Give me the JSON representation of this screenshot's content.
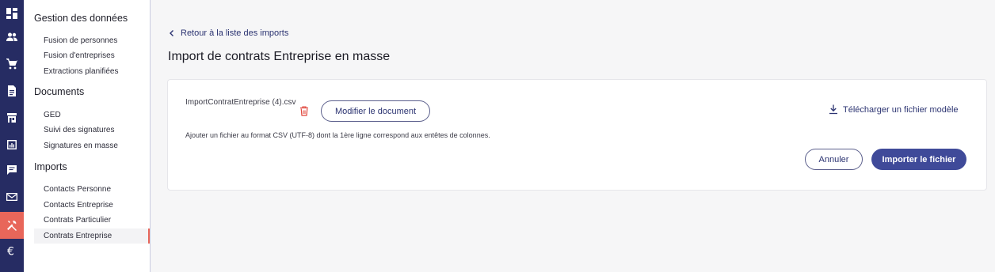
{
  "rail": {
    "items": [
      {
        "icon": "dashboard-icon"
      },
      {
        "icon": "people-icon"
      },
      {
        "icon": "cart-icon"
      },
      {
        "icon": "document-icon"
      },
      {
        "icon": "store-icon"
      },
      {
        "icon": "report-icon"
      },
      {
        "icon": "chat-icon"
      },
      {
        "icon": "mail-icon"
      },
      {
        "icon": "tools-icon"
      },
      {
        "icon": "euro-icon"
      }
    ],
    "active_index": 8,
    "active_color": "#e8665a",
    "background": "#262c63"
  },
  "subnav": {
    "sections": [
      {
        "title": "Gestion des données",
        "items": [
          "Fusion de personnes",
          "Fusion d'entreprises",
          "Extractions planifiées"
        ]
      },
      {
        "title": "Documents",
        "items": [
          "GED",
          "Suivi des signatures",
          "Signatures en masse"
        ]
      },
      {
        "title": "Imports",
        "items": [
          "Contacts Personne",
          "Contacts Entreprise",
          "Contrats Particulier",
          "Contrats Entreprise"
        ]
      }
    ],
    "active_item": "Contrats Entreprise"
  },
  "main": {
    "back_link": "Retour à la liste des imports",
    "title": "Import de contrats Entreprise en masse",
    "card": {
      "file_name": "ImportContratEntreprise (4).csv",
      "modify_button": "Modifier le document",
      "download_link": "Télécharger un fichier modèle",
      "hint": "Ajouter un fichier au format CSV (UTF-8) dont la 1ère ligne correspond aux entêtes de colonnes.",
      "cancel_button": "Annuler",
      "import_button": "Importer le fichier"
    }
  },
  "colors": {
    "primary": "#3f4a99",
    "danger": "#e0443a",
    "link": "#2b3371"
  }
}
